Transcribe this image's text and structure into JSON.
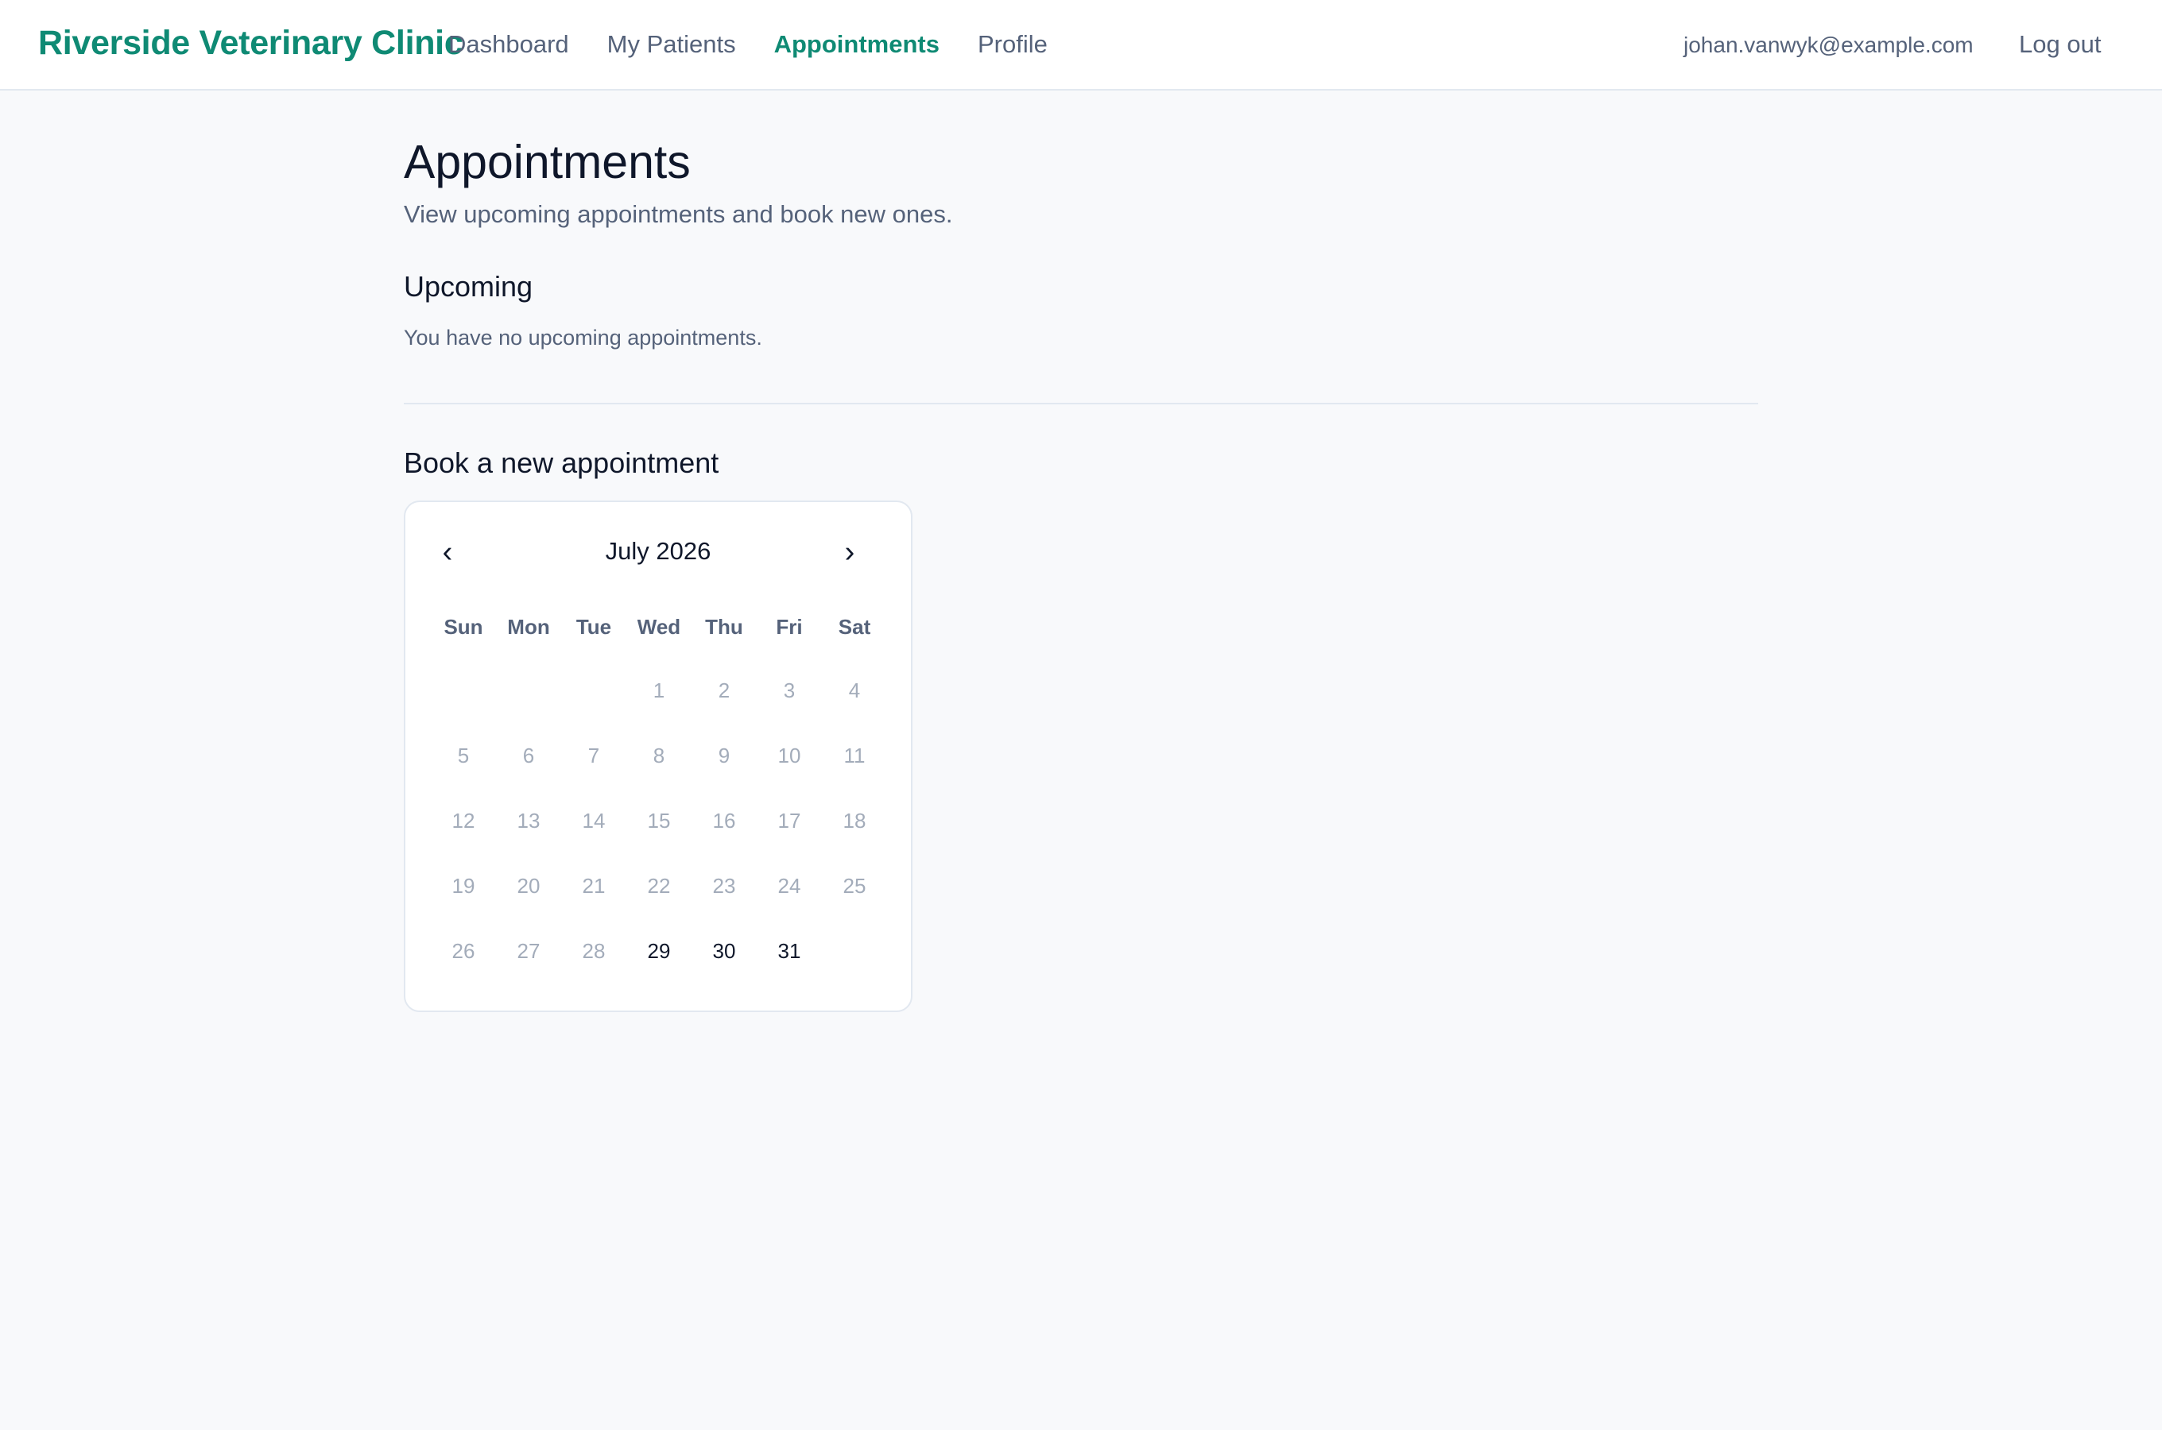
{
  "header": {
    "brand": "Riverside Veterinary Clinic",
    "nav": [
      {
        "label": "Dashboard",
        "active": false
      },
      {
        "label": "My Patients",
        "active": false
      },
      {
        "label": "Appointments",
        "active": true
      },
      {
        "label": "Profile",
        "active": false
      }
    ],
    "user_email": "johan.vanwyk@example.com",
    "logout_label": "Log out"
  },
  "page": {
    "title": "Appointments",
    "subtitle": "View upcoming appointments and book new ones."
  },
  "upcoming": {
    "heading": "Upcoming",
    "empty_message": "You have no upcoming appointments."
  },
  "booking": {
    "heading": "Book a new appointment",
    "calendar": {
      "prev_icon": "‹",
      "next_icon": "›",
      "month_label": "July 2026",
      "weekdays": [
        "Sun",
        "Mon",
        "Tue",
        "Wed",
        "Thu",
        "Fri",
        "Sat"
      ],
      "first_weekday_index": 3,
      "days": [
        {
          "day": "1",
          "available": false
        },
        {
          "day": "2",
          "available": false
        },
        {
          "day": "3",
          "available": false
        },
        {
          "day": "4",
          "available": false
        },
        {
          "day": "5",
          "available": false
        },
        {
          "day": "6",
          "available": false
        },
        {
          "day": "7",
          "available": false
        },
        {
          "day": "8",
          "available": false
        },
        {
          "day": "9",
          "available": false
        },
        {
          "day": "10",
          "available": false
        },
        {
          "day": "11",
          "available": false
        },
        {
          "day": "12",
          "available": false
        },
        {
          "day": "13",
          "available": false
        },
        {
          "day": "14",
          "available": false
        },
        {
          "day": "15",
          "available": false
        },
        {
          "day": "16",
          "available": false
        },
        {
          "day": "17",
          "available": false
        },
        {
          "day": "18",
          "available": false
        },
        {
          "day": "19",
          "available": false
        },
        {
          "day": "20",
          "available": false
        },
        {
          "day": "21",
          "available": false
        },
        {
          "day": "22",
          "available": false
        },
        {
          "day": "23",
          "available": false
        },
        {
          "day": "24",
          "available": false
        },
        {
          "day": "25",
          "available": false
        },
        {
          "day": "26",
          "available": false
        },
        {
          "day": "27",
          "available": false
        },
        {
          "day": "28",
          "available": false
        },
        {
          "day": "29",
          "available": true
        },
        {
          "day": "30",
          "available": true
        },
        {
          "day": "31",
          "available": true
        }
      ]
    }
  },
  "colors": {
    "brand": "#0f8a74",
    "text_primary": "#0f172a",
    "text_muted": "#55627a",
    "day_disabled": "#a3acba",
    "background": "#f8f9fb",
    "border": "#e2e8f0"
  }
}
